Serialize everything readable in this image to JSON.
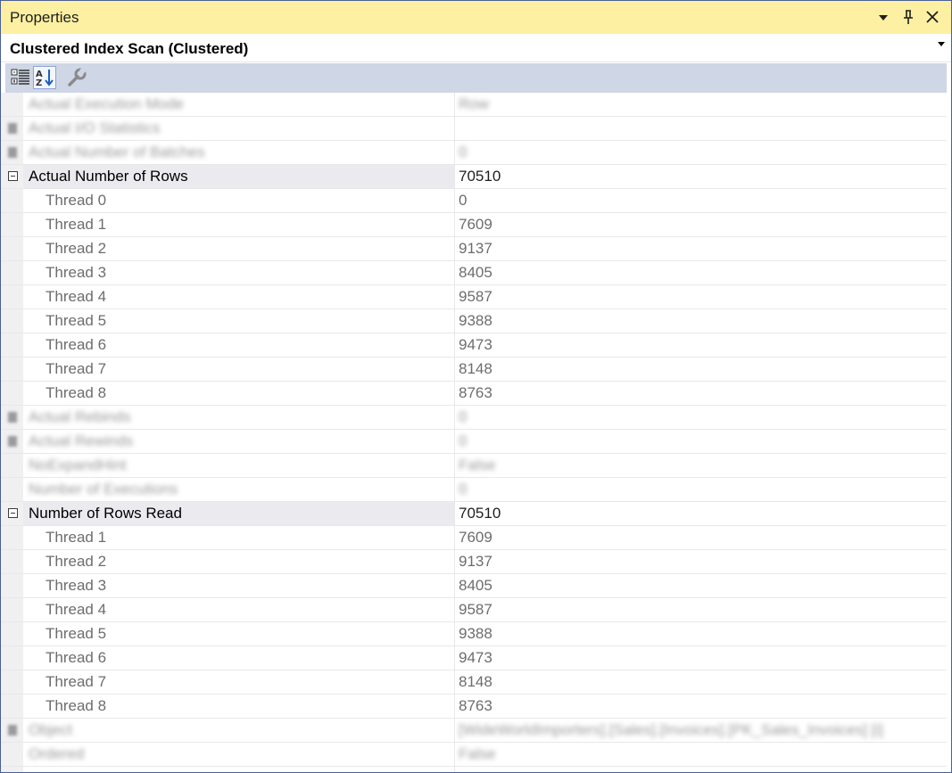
{
  "panel": {
    "title": "Properties",
    "object_name": "Clustered Index Scan (Clustered)",
    "buttons": {
      "dropdown": "▾",
      "pin": "⊥",
      "close": "✕"
    }
  },
  "toolbar": {
    "items": [
      {
        "name": "categorized-icon",
        "active": false
      },
      {
        "name": "alphabetical-sort-icon",
        "active": true
      },
      {
        "name": "property-pages-wrench-icon",
        "active": false
      }
    ]
  },
  "rows": [
    {
      "kind": "blur",
      "name": "Actual Execution Mode",
      "value": "Row"
    },
    {
      "kind": "blur-marker",
      "name": "Actual I/O Statistics",
      "value": ""
    },
    {
      "kind": "blur-marker",
      "name": "Actual Number of Batches",
      "value": "0"
    },
    {
      "kind": "group",
      "name": "Actual Number of Rows",
      "value": "70510"
    },
    {
      "kind": "sub",
      "name": "Thread 0",
      "value": "0"
    },
    {
      "kind": "sub",
      "name": "Thread 1",
      "value": "7609"
    },
    {
      "kind": "sub",
      "name": "Thread 2",
      "value": "9137"
    },
    {
      "kind": "sub",
      "name": "Thread 3",
      "value": "8405"
    },
    {
      "kind": "sub",
      "name": "Thread 4",
      "value": "9587"
    },
    {
      "kind": "sub",
      "name": "Thread 5",
      "value": "9388"
    },
    {
      "kind": "sub",
      "name": "Thread 6",
      "value": "9473"
    },
    {
      "kind": "sub",
      "name": "Thread 7",
      "value": "8148"
    },
    {
      "kind": "sub",
      "name": "Thread 8",
      "value": "8763"
    },
    {
      "kind": "blur-marker",
      "name": "Actual Rebinds",
      "value": "0"
    },
    {
      "kind": "blur-marker",
      "name": "Actual Rewinds",
      "value": "0"
    },
    {
      "kind": "blur",
      "name": "NoExpandHint",
      "value": "False"
    },
    {
      "kind": "blur",
      "name": "Number of Executions",
      "value": "0"
    },
    {
      "kind": "group",
      "name": "Number of Rows Read",
      "value": "70510"
    },
    {
      "kind": "sub",
      "name": "Thread 1",
      "value": "7609"
    },
    {
      "kind": "sub",
      "name": "Thread 2",
      "value": "9137"
    },
    {
      "kind": "sub",
      "name": "Thread 3",
      "value": "8405"
    },
    {
      "kind": "sub",
      "name": "Thread 4",
      "value": "9587"
    },
    {
      "kind": "sub",
      "name": "Thread 5",
      "value": "9388"
    },
    {
      "kind": "sub",
      "name": "Thread 6",
      "value": "9473"
    },
    {
      "kind": "sub",
      "name": "Thread 7",
      "value": "8148"
    },
    {
      "kind": "sub",
      "name": "Thread 8",
      "value": "8763"
    },
    {
      "kind": "blur-marker",
      "name": "Object",
      "value": "[WideWorldImporters].[Sales].[Invoices].[PK_Sales_Invoices] [i]"
    },
    {
      "kind": "blur",
      "name": "Ordered",
      "value": "False"
    }
  ]
}
